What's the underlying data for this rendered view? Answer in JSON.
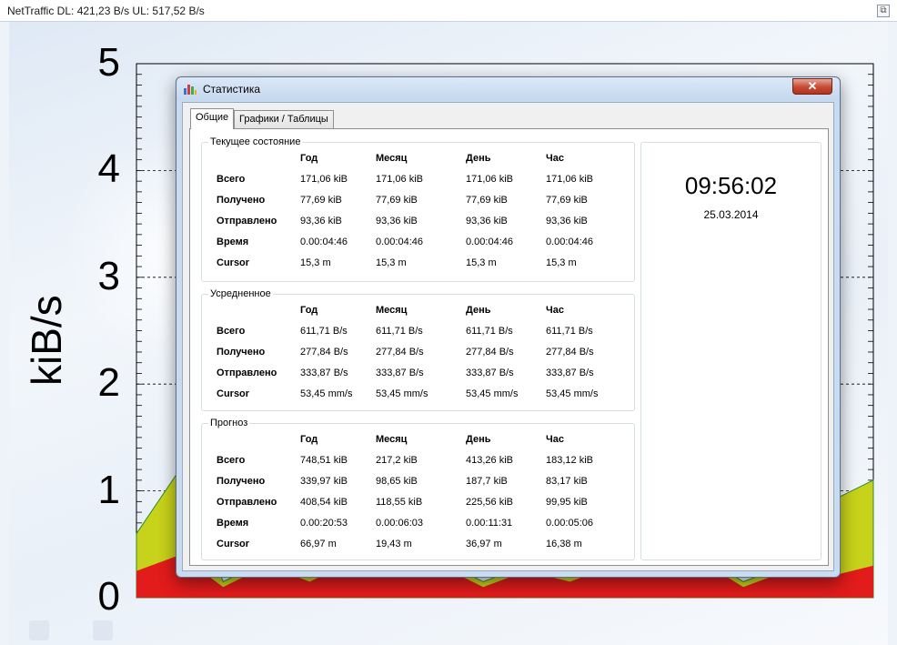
{
  "main_window": {
    "title": "NetTraffic DL: 421,23 B/s UL: 517,52 B/s",
    "close_glyph": "⧉"
  },
  "chart_data": {
    "type": "area",
    "ylabel": "kiB/s",
    "ylim": [
      0,
      5
    ],
    "yticks": [
      "0",
      "1",
      "2",
      "3",
      "4",
      "5"
    ],
    "grid": true,
    "series": [
      {
        "values": [
          0.25,
          0.4,
          0.1,
          0.3,
          0.15,
          0.35,
          0.2,
          0.3,
          0.1,
          0.25,
          0.15,
          0.3,
          0.2,
          0.35,
          0.1,
          0.25,
          0.2,
          0.3
        ]
      },
      {
        "values": [
          0.6,
          1.2,
          0.15,
          0.35,
          0.2,
          0.4,
          0.25,
          0.35,
          0.15,
          0.3,
          0.2,
          0.35,
          0.25,
          0.4,
          0.15,
          0.3,
          0.9,
          1.1
        ]
      }
    ],
    "colors": {
      "download": "#e21b1b",
      "upload": "#c7d21a",
      "edge": "#2f8a2f"
    }
  },
  "dialog": {
    "title": "Статистика",
    "close_glyph": "✕",
    "tabs": [
      {
        "label": "Общие",
        "active": true
      },
      {
        "label": "Графики / Таблицы",
        "active": false
      }
    ],
    "columns": [
      "Год",
      "Месяц",
      "День",
      "Час"
    ],
    "groups": [
      {
        "title": "Текущее состояние",
        "rows": [
          {
            "label": "Всего",
            "values": [
              "171,06 kiB",
              "171,06 kiB",
              "171,06 kiB",
              "171,06 kiB"
            ]
          },
          {
            "label": "Получено",
            "values": [
              "77,69 kiB",
              "77,69 kiB",
              "77,69 kiB",
              "77,69 kiB"
            ]
          },
          {
            "label": "Отправлено",
            "values": [
              "93,36 kiB",
              "93,36 kiB",
              "93,36 kiB",
              "93,36 kiB"
            ]
          },
          {
            "label": "Время",
            "values": [
              "0.00:04:46",
              "0.00:04:46",
              "0.00:04:46",
              "0.00:04:46"
            ]
          },
          {
            "label": "Cursor",
            "values": [
              "15,3 m",
              "15,3 m",
              "15,3 m",
              "15,3 m"
            ]
          }
        ]
      },
      {
        "title": "Усредненное",
        "rows": [
          {
            "label": "Всего",
            "values": [
              "611,71 B/s",
              "611,71 B/s",
              "611,71 B/s",
              "611,71 B/s"
            ]
          },
          {
            "label": "Получено",
            "values": [
              "277,84 B/s",
              "277,84 B/s",
              "277,84 B/s",
              "277,84 B/s"
            ]
          },
          {
            "label": "Отправлено",
            "values": [
              "333,87 B/s",
              "333,87 B/s",
              "333,87 B/s",
              "333,87 B/s"
            ]
          },
          {
            "label": "Cursor",
            "values": [
              "53,45 mm/s",
              "53,45 mm/s",
              "53,45 mm/s",
              "53,45 mm/s"
            ]
          }
        ]
      },
      {
        "title": "Прогноз",
        "rows": [
          {
            "label": "Всего",
            "values": [
              "748,51 kiB",
              "217,2 kiB",
              "413,26 kiB",
              "183,12 kiB"
            ]
          },
          {
            "label": "Получено",
            "values": [
              "339,97 kiB",
              "98,65 kiB",
              "187,7 kiB",
              "83,17 kiB"
            ]
          },
          {
            "label": "Отправлено",
            "values": [
              "408,54 kiB",
              "118,55 kiB",
              "225,56 kiB",
              "99,95 kiB"
            ]
          },
          {
            "label": "Время",
            "values": [
              "0.00:20:53",
              "0.00:06:03",
              "0.00:11:31",
              "0.00:05:06"
            ]
          },
          {
            "label": "Cursor",
            "values": [
              "66,97 m",
              "19,43 m",
              "36,97 m",
              "16,38 m"
            ]
          }
        ]
      }
    ],
    "clock": {
      "time": "09:56:02",
      "date": "25.03.2014"
    }
  }
}
